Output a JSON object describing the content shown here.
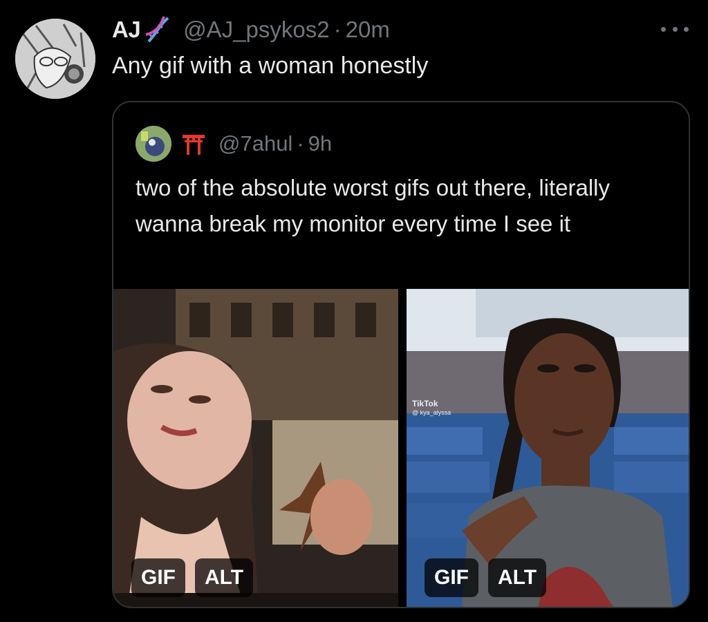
{
  "tweet": {
    "display_name": "AJ",
    "name_icon": "dna-icon",
    "handle": "@AJ_psykos2",
    "separator": "·",
    "time": "20m",
    "text": "Any gif with a woman honestly"
  },
  "quoted": {
    "name_icon": "torii-gate-icon",
    "handle": "@7ahul",
    "separator": "·",
    "time": "9h",
    "text": "two of the absolute worst gifs out there, literally wanna break my monitor every time I see it",
    "media": [
      {
        "gif_label": "GIF",
        "alt_label": "ALT"
      },
      {
        "gif_label": "GIF",
        "alt_label": "ALT",
        "watermark": "TikTok",
        "watermark_user": "@ kya_alyssa"
      }
    ]
  },
  "colors": {
    "background": "#000000",
    "text_primary": "#e7e9ea",
    "text_secondary": "#71767b",
    "border": "#2f3336"
  }
}
